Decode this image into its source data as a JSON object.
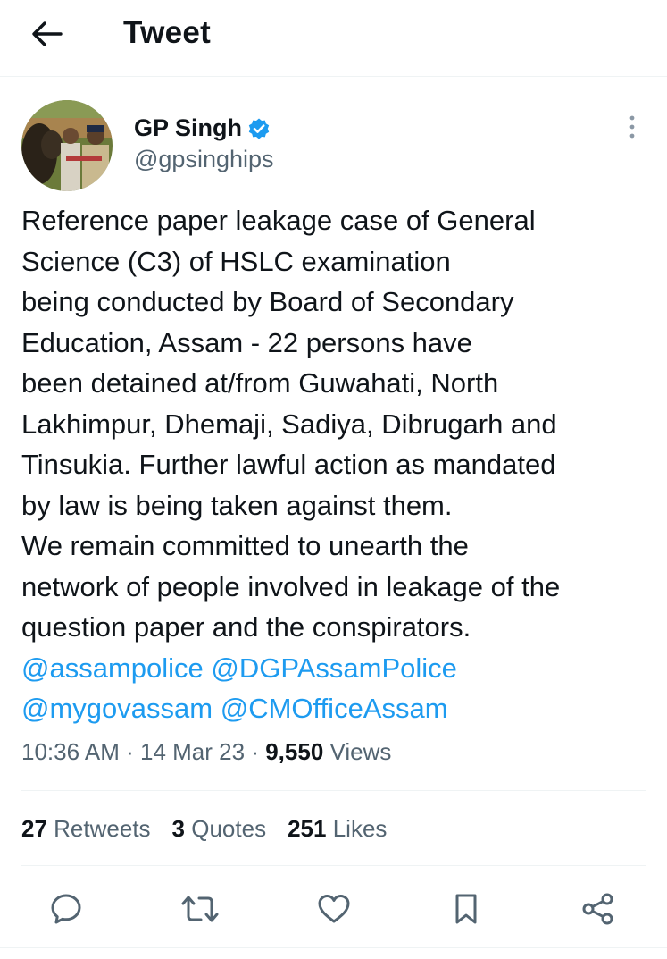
{
  "header": {
    "title": "Tweet",
    "back_icon": "arrow-left-icon"
  },
  "author": {
    "name": "GP Singh",
    "handle": "@gpsinghips",
    "verified": true,
    "verified_color": "#1d9bf0"
  },
  "tweet": {
    "lines": [
      "Reference paper leakage case of General",
      "Science (C3) of HSLC examination",
      "being conducted by Board of Secondary",
      "Education, Assam - 22 persons have",
      "been detained at/from Guwahati, North",
      "Lakhimpur, Dhemaji, Sadiya, Dibrugarh and",
      "Tinsukia. Further lawful action as mandated",
      "by law is being taken against them.",
      "We remain committed to unearth the",
      "network of people involved in leakage of the",
      "question paper and the conspirators."
    ],
    "mentions": [
      "@assampolice",
      "@DGPAssamPolice",
      "@mygovassam",
      "@CMOfficeAssam"
    ],
    "mention_color": "#1d9bf0"
  },
  "meta": {
    "time": "10:36 AM",
    "date": "14 Mar 23",
    "separator": "·",
    "views_count": "9,550",
    "views_label": "Views"
  },
  "stats": {
    "retweets_count": "27",
    "retweets_label": "Retweets",
    "quotes_count": "3",
    "quotes_label": "Quotes",
    "likes_count": "251",
    "likes_label": "Likes"
  },
  "actions": [
    "reply-icon",
    "retweet-icon",
    "like-icon",
    "bookmark-icon",
    "share-icon"
  ],
  "colors": {
    "text": "#0f1419",
    "secondary": "#536471",
    "divider": "#eff3f4"
  }
}
